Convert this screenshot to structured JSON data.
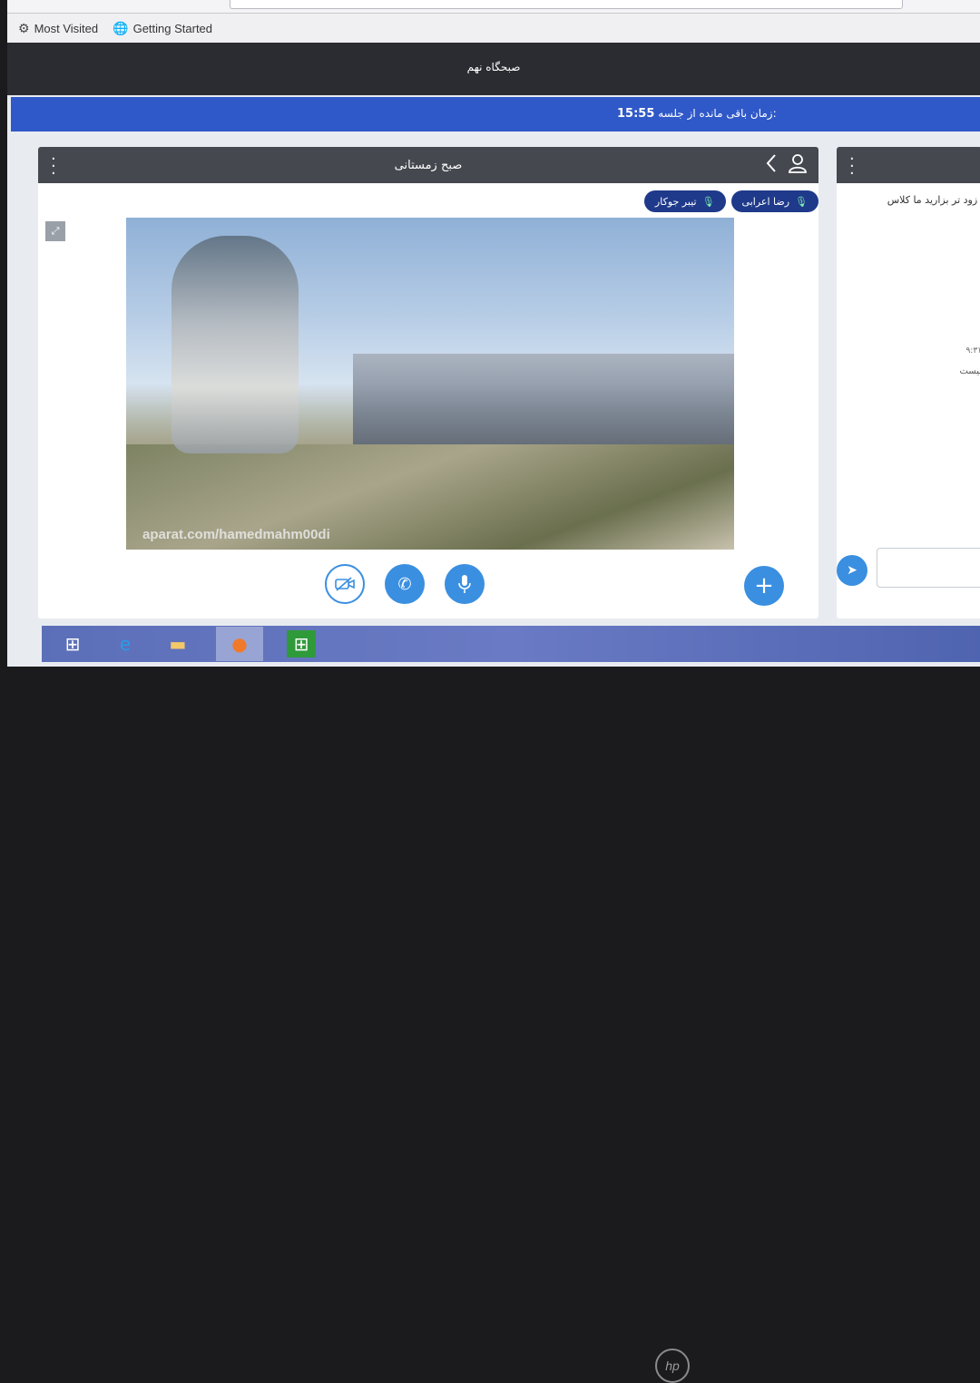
{
  "browser": {
    "bookmarks": [
      {
        "label": "Most Visited",
        "icon": "gear-icon"
      },
      {
        "label": "Getting Started",
        "icon": "globe-icon"
      }
    ]
  },
  "app": {
    "title": "صبحگاه نهم"
  },
  "timer": {
    "label": "زمان باقی مانده از جلسه:",
    "value": "15:55"
  },
  "room": {
    "title": "صبح زمستانی",
    "participants": [
      "رضا اعرابی",
      "تیبر جوکار"
    ]
  },
  "video": {
    "watermark": "aparat.com/hamedmahm00di"
  },
  "controls": [
    "camera-off",
    "phone",
    "microphone"
  ],
  "chat": {
    "message": "ر زود تر بزارید ما کلاس",
    "time_fragment": "۹:۳۱",
    "text_fragment": "نیست"
  },
  "taskbar": [
    "windows-start",
    "internet-explorer",
    "file-explorer",
    "firefox",
    "store"
  ],
  "accent": "#3a8fe0",
  "header_bar_color": "#2f58c8"
}
